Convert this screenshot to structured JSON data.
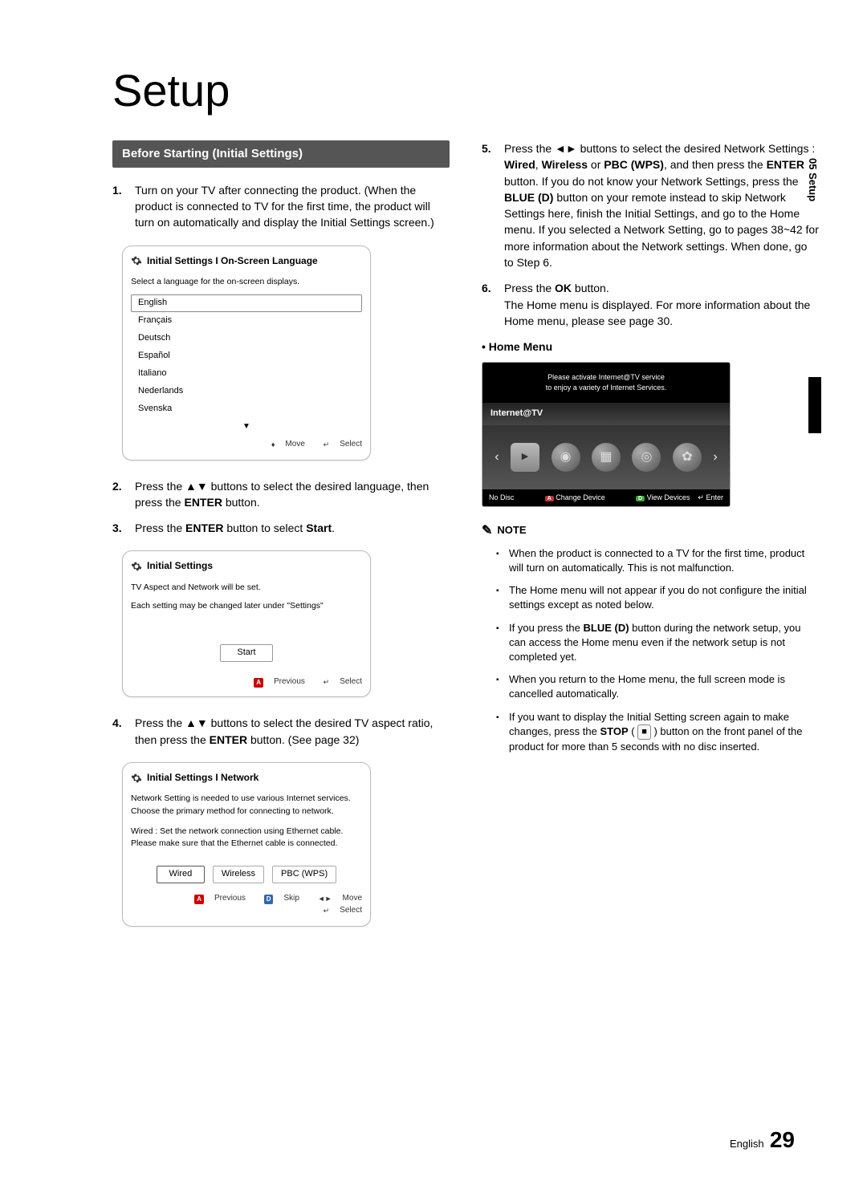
{
  "page": {
    "title": "Setup",
    "section_header": "Before Starting (Initial Settings)",
    "side_tab": "05  Setup",
    "footer_lang": "English",
    "footer_num": "29"
  },
  "left": {
    "step1": "Turn on your TV after connecting the product. (When the product is connected to TV for the first time, the product will turn on automatically and display the Initial Settings screen.)",
    "ui1": {
      "title": "Initial Settings I On-Screen Language",
      "label": "Select a language for the on-screen displays.",
      "langs": [
        "English",
        "Français",
        "Deutsch",
        "Español",
        "Italiano",
        "Nederlands",
        "Svenska"
      ],
      "foot_move": "Move",
      "foot_select": "Select"
    },
    "step2_a": "Press the ",
    "step2_b": " buttons to select the desired language, then press the ",
    "step2_c": " button.",
    "enter": "ENTER",
    "step3_a": "Press the ",
    "step3_b": " button to select ",
    "step3_c": ".",
    "start": "Start",
    "ui2": {
      "title": "Initial Settings",
      "line1": "TV Aspect and Network will be set.",
      "line2": "Each setting may be changed later under \"Settings\"",
      "btn": "Start",
      "prev": "Previous",
      "select": "Select"
    },
    "step4_a": "Press the ",
    "step4_b": " buttons to select the desired TV aspect ratio, then press the ",
    "step4_c": " button. (See page 32)",
    "ui3": {
      "title": "Initial Settings I Network",
      "line1": "Network Setting is needed to use various Internet services. Choose the primary method for connecting to network.",
      "line2": "Wired : Set the network connection using Ethernet cable. Please make sure that the Ethernet cable is connected.",
      "btns": [
        "Wired",
        "Wireless",
        "PBC (WPS)"
      ],
      "prev": "Previous",
      "skip": "Skip",
      "move": "Move",
      "select": "Select"
    }
  },
  "right": {
    "step5_a": "Press the ",
    "step5_b": " buttons to select the desired Network Settings : ",
    "wired": "Wired",
    "wireless": "Wireless",
    "or": " or ",
    "pbc": "PBC (WPS)",
    "step5_c": ", and then press the ",
    "step5_d": " button. If you do not know your Network Settings, press the ",
    "blue_d": "BLUE (D)",
    "step5_e": " button on your remote instead to skip Network Settings here, finish the Initial Settings, and go to the Home menu. If you selected a Network Setting, go to pages 38~42 for more information about the Network settings. When done, go to Step 6.",
    "step6_a": "Press the ",
    "ok": "OK",
    "step6_b": " button.",
    "step6_body": "The Home menu is displayed. For more information about the Home menu, please see page 30.",
    "home_bullet": "• Home Menu",
    "home": {
      "top1": "Please activate Internet@TV service",
      "top2": "to enjoy a variety of Internet Services.",
      "title": "Internet@TV",
      "bottom_left": "No Disc",
      "change": "Change Device",
      "view": "View Devices",
      "enter": "Enter"
    },
    "note_label": "NOTE",
    "notes": {
      "n1": "When the product is connected to a TV for the first time, product will turn on automatically. This is not malfunction.",
      "n2": "The Home menu will not appear if you do not configure the initial settings except as noted below.",
      "n3_a": "If you press the ",
      "n3_b": " button during the network setup, you can access the Home menu even if the network setup is not completed yet.",
      "n4": "When you return to the Home menu, the full screen mode is cancelled automatically.",
      "n5_a": "If you want to display the Initial Setting screen again to make changes, press the ",
      "stop": "STOP",
      "n5_b": " button on the front panel of the product for more than 5 seconds with no disc inserted."
    }
  }
}
